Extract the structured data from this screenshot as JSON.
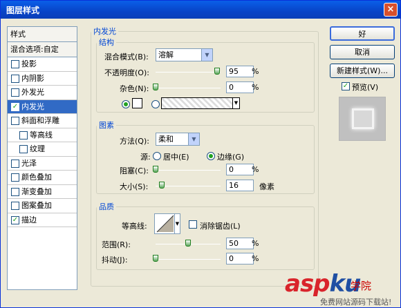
{
  "window": {
    "title": "图层样式",
    "close": "×"
  },
  "styles_list": {
    "header": "样式",
    "blend": "混合选项:自定",
    "items": [
      {
        "label": "投影",
        "checked": false,
        "indent": false,
        "selected": false
      },
      {
        "label": "内阴影",
        "checked": false,
        "indent": false,
        "selected": false
      },
      {
        "label": "外发光",
        "checked": false,
        "indent": false,
        "selected": false
      },
      {
        "label": "内发光",
        "checked": true,
        "indent": false,
        "selected": true
      },
      {
        "label": "斜面和浮雕",
        "checked": false,
        "indent": false,
        "selected": false
      },
      {
        "label": "等高线",
        "checked": false,
        "indent": true,
        "selected": false
      },
      {
        "label": "纹理",
        "checked": false,
        "indent": true,
        "selected": false
      },
      {
        "label": "光泽",
        "checked": false,
        "indent": false,
        "selected": false
      },
      {
        "label": "颜色叠加",
        "checked": false,
        "indent": false,
        "selected": false
      },
      {
        "label": "渐变叠加",
        "checked": false,
        "indent": false,
        "selected": false
      },
      {
        "label": "图案叠加",
        "checked": false,
        "indent": false,
        "selected": false
      },
      {
        "label": "描边",
        "checked": true,
        "indent": false,
        "selected": false
      }
    ]
  },
  "panel": {
    "title": "内发光",
    "structure": {
      "title": "结构",
      "blend_mode_label": "混合模式(B):",
      "blend_mode_value": "溶解",
      "opacity_label": "不透明度(O):",
      "opacity_value": "95",
      "opacity_level": 95,
      "noise_label": "杂色(N):",
      "noise_value": "0",
      "noise_level": 0,
      "percent": "%"
    },
    "elements": {
      "title": "图素",
      "method_label": "方法(Q):",
      "method_value": "柔和",
      "source_label": "源:",
      "center_label": "居中(E)",
      "edge_label": "边缘(G)",
      "choke_label": "阻塞(C):",
      "choke_value": "0",
      "choke_level": 0,
      "size_label": "大小(S):",
      "size_value": "16",
      "size_unit": "像素",
      "percent": "%"
    },
    "quality": {
      "title": "品质",
      "contour_label": "等高线:",
      "antialias_label": "消除锯齿(L)",
      "range_label": "范围(R):",
      "range_value": "50",
      "range_level": 50,
      "jitter_label": "抖动(J):",
      "jitter_value": "0",
      "jitter_level": 0,
      "percent": "%"
    }
  },
  "buttons": {
    "ok": "好",
    "cancel": "取消",
    "new_style": "新建样式(W)...",
    "preview": "预览(V)"
  },
  "watermark": {
    "brand_a": "asp",
    "brand_k": "ku",
    "suffix": "学院",
    "footer": "免费网站源码下载站!"
  }
}
